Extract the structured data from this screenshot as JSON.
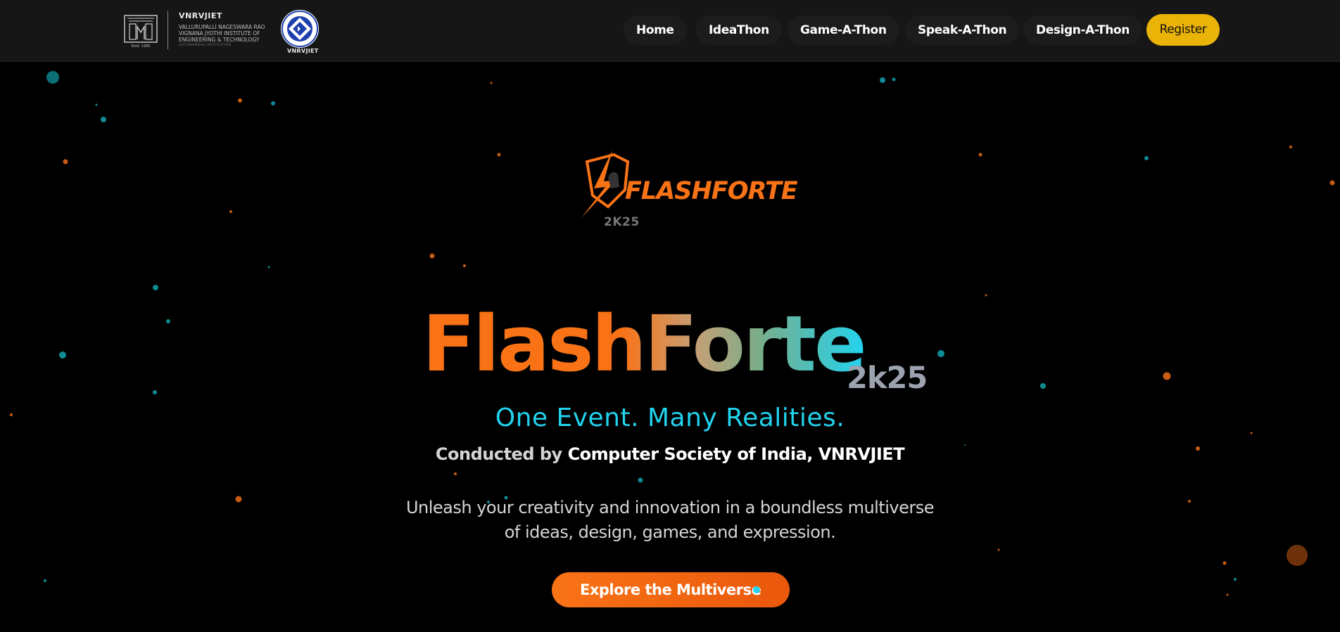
{
  "navbar": {
    "college_short": "VNRVJIET",
    "college_full": "Vallurupalli Nageswara Rao Vignana Jyothi Institute of Engineering & Technology",
    "college_tag": "Autonomous Institution",
    "csi_caption": "VNRVJIET",
    "links": [
      {
        "label": "Home"
      },
      {
        "label": "IdeaThon"
      },
      {
        "label": "Game-A-Thon"
      },
      {
        "label": "Speak-A-Thon"
      },
      {
        "label": "Design-A-Thon"
      }
    ],
    "register_label": "Register"
  },
  "hero": {
    "logo_word": "FLASHFORTE",
    "logo_year": "2K25",
    "title": "FlashForte",
    "year": "2k25",
    "tagline": "One Event. Many Realities.",
    "conducted_prefix": "Conducted by ",
    "conducted_org": "Computer Society of India, VNRVJIET",
    "description_line1": "Unleash your creativity and innovation in a boundless multiverse",
    "description_line2": "of ideas, design, games, and expression.",
    "cta_label": "Explore the Multiverse"
  },
  "colors": {
    "accent_orange": "#f97316",
    "accent_cyan": "#22d3ee",
    "register_yellow": "#eab308",
    "navbar_bg": "#161616",
    "page_bg": "#000000"
  }
}
